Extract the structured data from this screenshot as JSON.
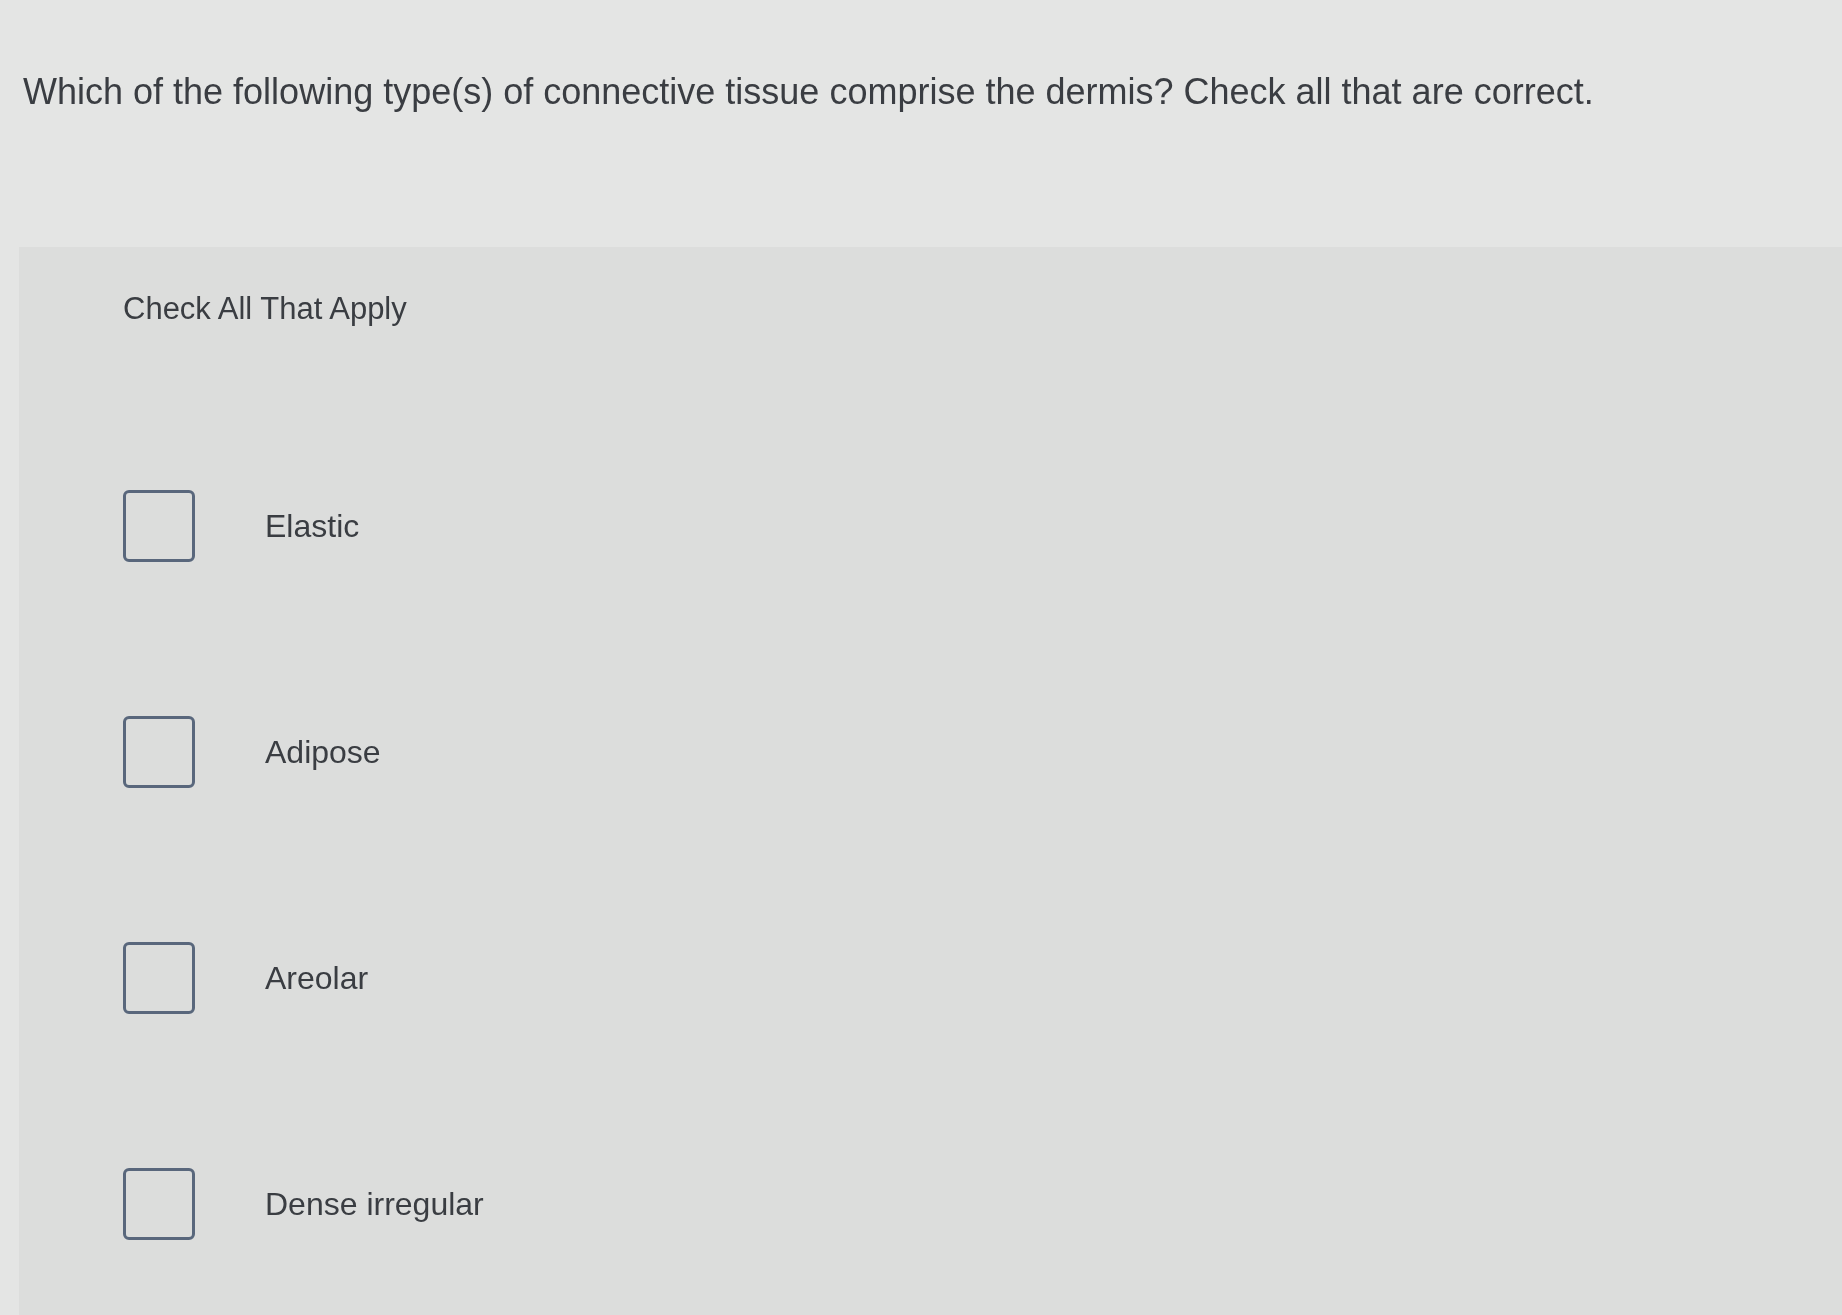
{
  "question": "Which of the following type(s) of connective tissue comprise the dermis?  Check all that are correct.",
  "instruction": "Check All That Apply",
  "options": [
    {
      "label": "Elastic",
      "checked": false
    },
    {
      "label": "Adipose",
      "checked": false
    },
    {
      "label": "Areolar",
      "checked": false
    },
    {
      "label": "Dense irregular",
      "checked": false
    }
  ]
}
